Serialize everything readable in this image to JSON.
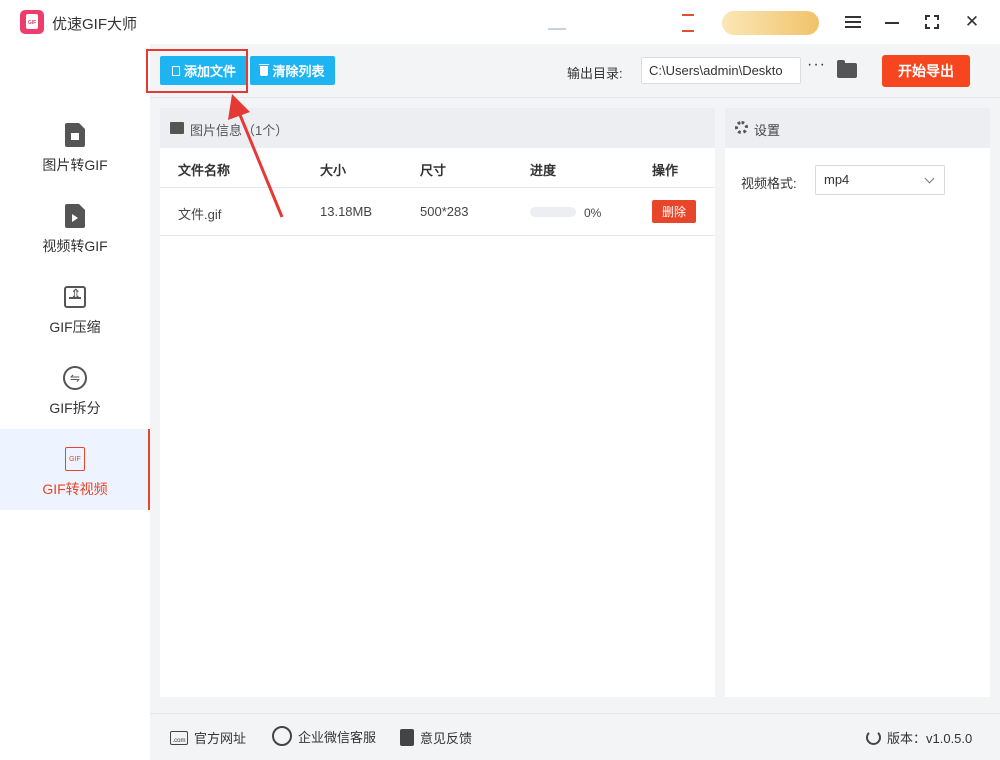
{
  "app": {
    "title": "优速GIF大师",
    "logo_text": "GIF"
  },
  "sidebar": {
    "items": [
      {
        "label": "图片转GIF",
        "icon": "image-file-icon"
      },
      {
        "label": "视频转GIF",
        "icon": "video-file-icon"
      },
      {
        "label": "GIF压缩",
        "icon": "compress-icon"
      },
      {
        "label": "GIF拆分",
        "icon": "split-icon"
      },
      {
        "label": "GIF转视频",
        "icon": "gif-file-icon",
        "active": true,
        "icon_text": "GIF"
      }
    ]
  },
  "toolbar": {
    "add_label": "添加文件",
    "clear_label": "清除列表",
    "output_label": "输出目录:",
    "output_path": "C:\\Users\\admin\\Deskto",
    "more_label": "···",
    "export_label": "开始导出"
  },
  "file_panel": {
    "title": "图片信息（1个）",
    "columns": [
      "文件名称",
      "大小",
      "尺寸",
      "进度",
      "操作"
    ],
    "rows": [
      {
        "name": "文件.gif",
        "size": "13.18MB",
        "dimensions": "500*283",
        "progress": 0,
        "progress_text": "0%",
        "action": "删除"
      }
    ]
  },
  "settings": {
    "title": "设置",
    "format_label": "视频格式:",
    "format_value": "mp4"
  },
  "footer": {
    "website": "官方网址",
    "wechat": "企业微信客服",
    "feedback": "意见反馈",
    "version": "版本：v1.0.5.0"
  },
  "colors": {
    "accent_blue": "#1eb4f1",
    "accent_red": "#f5461f",
    "highlight": "#e53935"
  }
}
